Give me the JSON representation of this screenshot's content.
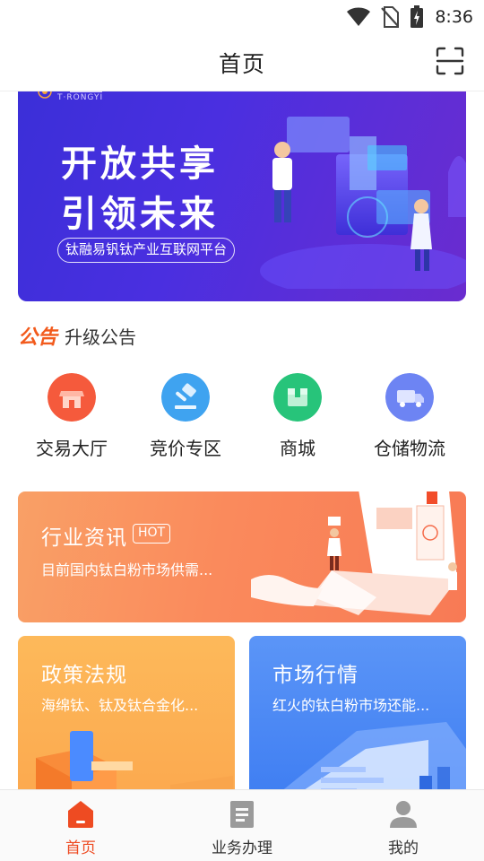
{
  "status_bar": {
    "time": "8:36"
  },
  "header": {
    "title": "首页"
  },
  "banner": {
    "logo_text": "T·RONGYI",
    "line1": "开放共享",
    "line2": "引领未来",
    "pill": "钛融易钒钛产业互联网平台"
  },
  "notice": {
    "tag": "公告",
    "text": "升级公告"
  },
  "quick_menu": [
    {
      "label": "交易大厅",
      "icon": "store-icon",
      "color": "#f55a3c"
    },
    {
      "label": "竞价专区",
      "icon": "gavel-icon",
      "color": "#3fa3f0"
    },
    {
      "label": "商城",
      "icon": "package-icon",
      "color": "#27c47a"
    },
    {
      "label": "仓储物流",
      "icon": "truck-icon",
      "color": "#6d84f3"
    }
  ],
  "news": {
    "title": "行业资讯",
    "badge": "HOT",
    "desc": "目前国内钛白粉市场供需..."
  },
  "cards": {
    "policy": {
      "title": "政策法规",
      "desc": "海绵钛、钛及钛合金化..."
    },
    "market": {
      "title": "市场行情",
      "desc": "红火的钛白粉市场还能..."
    }
  },
  "bottom_nav": [
    {
      "label": "首页",
      "icon": "home-icon",
      "active": true
    },
    {
      "label": "业务办理",
      "icon": "document-icon",
      "active": false
    },
    {
      "label": "我的",
      "icon": "user-icon",
      "active": false
    }
  ],
  "colors": {
    "accent": "#ee4b22",
    "banner": "#4a2fe0"
  }
}
